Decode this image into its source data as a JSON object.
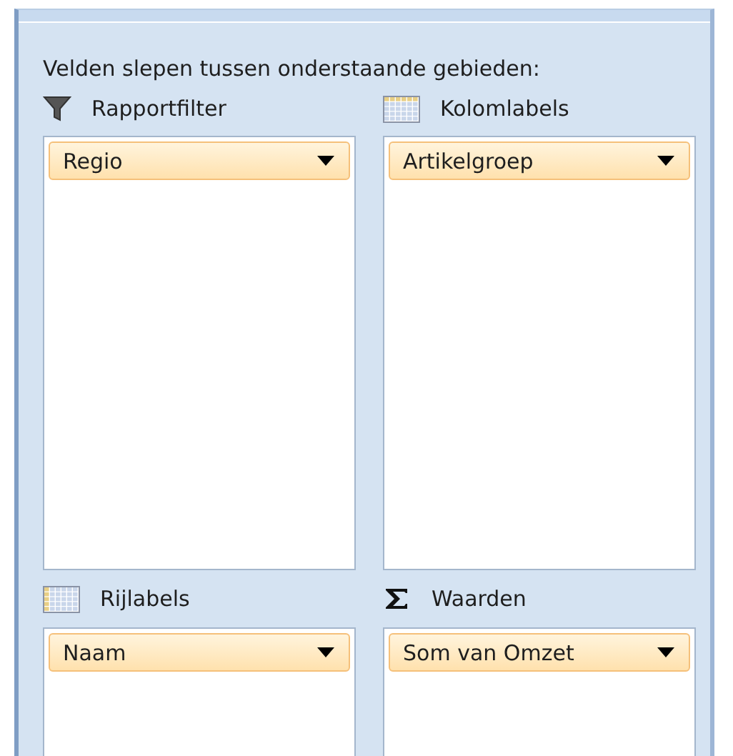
{
  "instruction": "Velden slepen tussen onderstaande gebieden:",
  "areas": [
    {
      "kind": "filter",
      "label": "Rapportfilter",
      "fields": [
        "Regio"
      ]
    },
    {
      "kind": "columns",
      "label": "Kolomlabels",
      "fields": [
        "Artikelgroep"
      ]
    },
    {
      "kind": "rows",
      "label": "Rijlabels",
      "fields": [
        "Naam"
      ]
    },
    {
      "kind": "values",
      "label": "Waarden",
      "fields": [
        "Som van Omzet"
      ]
    }
  ]
}
